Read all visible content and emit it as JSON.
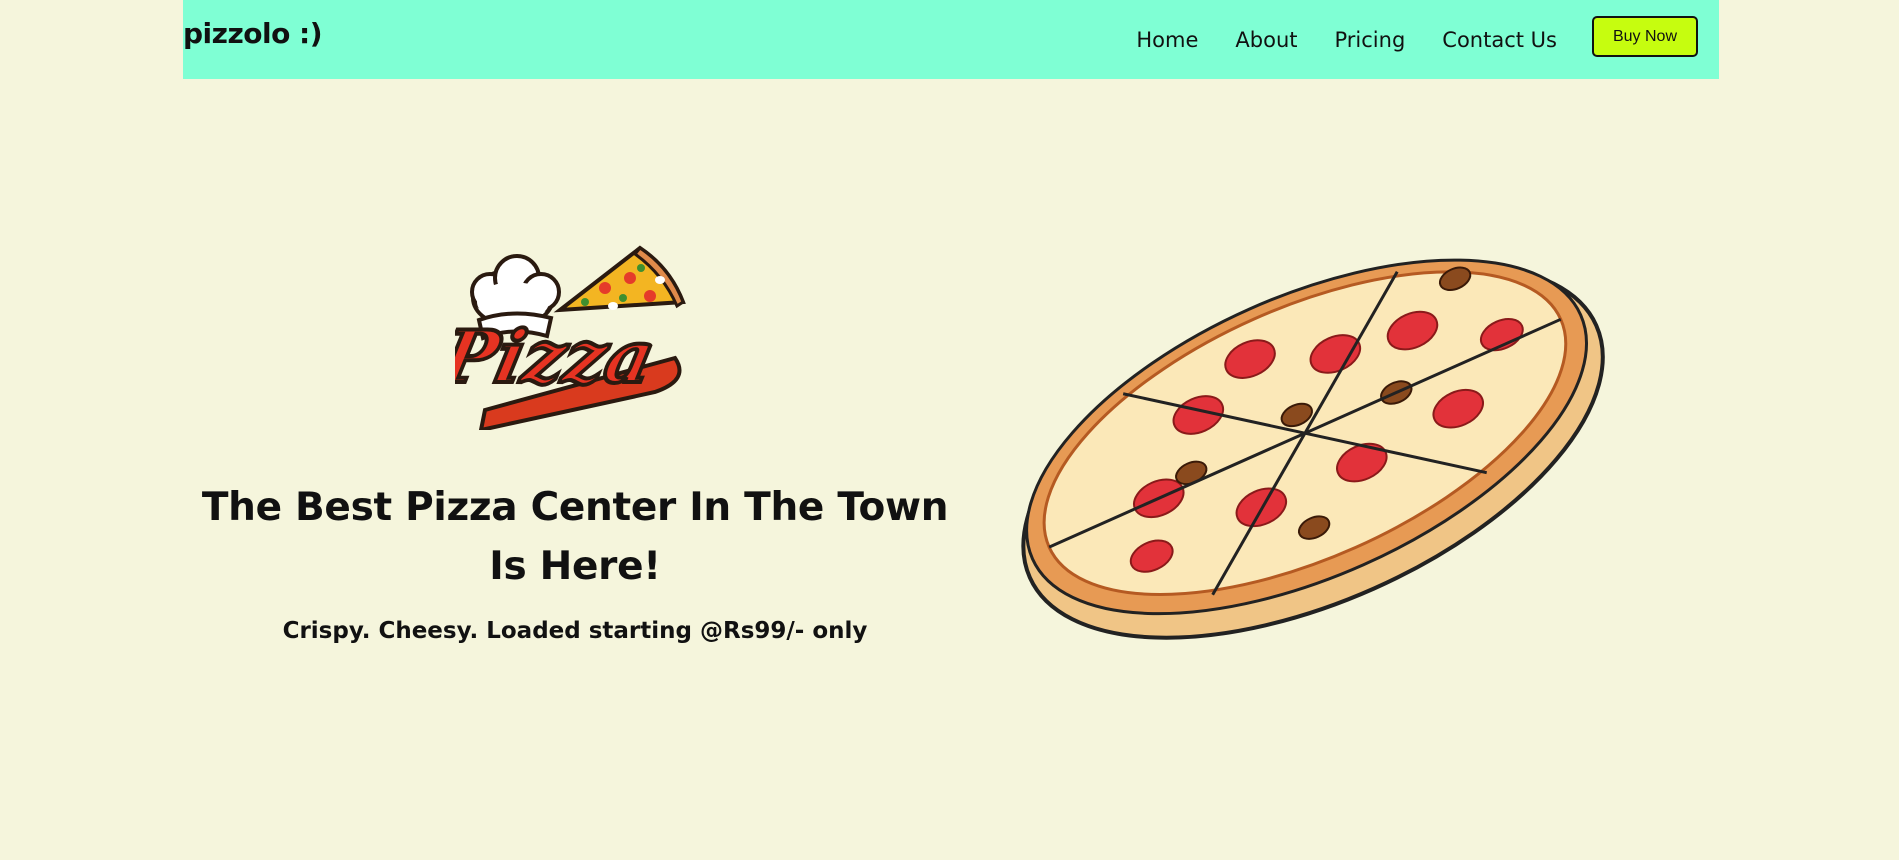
{
  "header": {
    "brand": "pizzolo :)",
    "nav": [
      {
        "label": "Home"
      },
      {
        "label": "About"
      },
      {
        "label": "Pricing"
      },
      {
        "label": "Contact Us"
      }
    ],
    "cta_label": "Buy Now"
  },
  "hero": {
    "headline": "The Best Pizza Center In The Town Is Here!",
    "subline": "Crispy. Cheesy. Loaded starting @Rs99/- only",
    "logo_text": "Pizza",
    "logo_icon": "pizza-logo-icon",
    "image_icon": "pizza-illustration"
  },
  "colors": {
    "background": "#f5f5dc",
    "navbar": "#7fffd4",
    "cta": "#c6fd0f",
    "text": "#111111"
  }
}
